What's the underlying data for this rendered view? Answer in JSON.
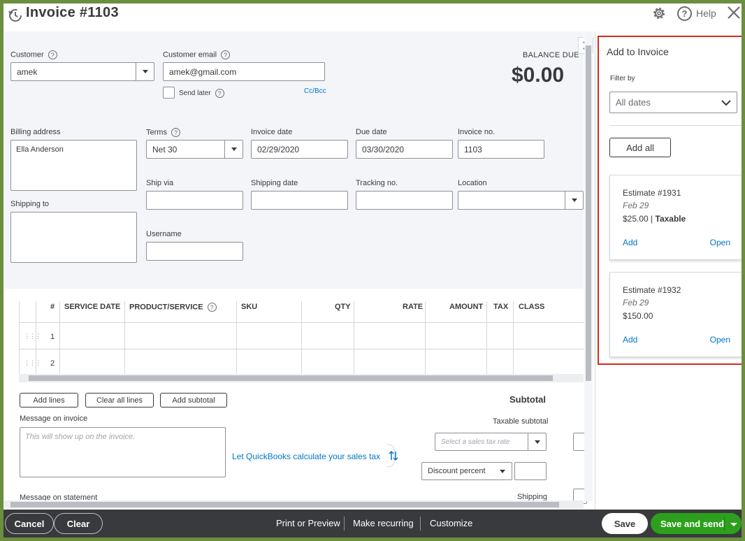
{
  "header": {
    "title": "Invoice #1103",
    "help": "Help"
  },
  "customer": {
    "label": "Customer",
    "value": "amek",
    "email_label": "Customer email",
    "email_value": "amek@gmail.com",
    "send_later": "Send later",
    "ccbcc": "Cc/Bcc"
  },
  "balance": {
    "label": "BALANCE DUE",
    "amount": "$0.00"
  },
  "billing": {
    "label": "Billing address",
    "value": "Ella Anderson",
    "shipping_label": "Shipping to"
  },
  "terms": {
    "label": "Terms",
    "value": "Net 30"
  },
  "invoice_date": {
    "label": "Invoice date",
    "value": "02/29/2020"
  },
  "due_date": {
    "label": "Due date",
    "value": "03/30/2020"
  },
  "invoice_no": {
    "label": "Invoice no.",
    "value": "1103"
  },
  "ship": {
    "via": "Ship via",
    "date": "Shipping date",
    "tracking": "Tracking no.",
    "location": "Location",
    "username": "Username"
  },
  "table": {
    "headers": [
      "#",
      "SERVICE DATE",
      "PRODUCT/SERVICE",
      "SKU",
      "QTY",
      "RATE",
      "AMOUNT",
      "TAX",
      "CLASS"
    ],
    "rows": [
      "1",
      "2"
    ]
  },
  "actions": {
    "add_lines": "Add lines",
    "clear_all": "Clear all lines",
    "add_subtotal": "Add subtotal"
  },
  "summary": {
    "subtotal": "Subtotal",
    "taxable": "Taxable subtotal",
    "tax_rate_placeholder": "Select a sales tax rate",
    "discount": "Discount percent",
    "shipping": "Shipping",
    "qb_link": "Let QuickBooks calculate your sales tax"
  },
  "messages": {
    "invoice_label": "Message on invoice",
    "invoice_placeholder": "This will show up on the invoice.",
    "statement_label": "Message on statement"
  },
  "panel": {
    "title": "Add to Invoice",
    "filter_label": "Filter by",
    "filter_value": "All dates",
    "add_all": "Add all",
    "cards": [
      {
        "title": "Estimate #1931",
        "date": "Feb 29",
        "amount": "$25.00",
        "taxable": "Taxable",
        "add": "Add",
        "open": "Open"
      },
      {
        "title": "Estimate #1932",
        "date": "Feb 29",
        "amount": "$150.00",
        "add": "Add",
        "open": "Open"
      }
    ]
  },
  "footer": {
    "cancel": "Cancel",
    "clear": "Clear",
    "print": "Print or Preview",
    "recurring": "Make recurring",
    "customize": "Customize",
    "save": "Save",
    "save_send": "Save and send"
  },
  "colors": {
    "accent_green": "#2ca01c",
    "link_blue": "#0077c5",
    "footer_bg": "#393a3d",
    "highlight_red": "#d52b1e"
  }
}
